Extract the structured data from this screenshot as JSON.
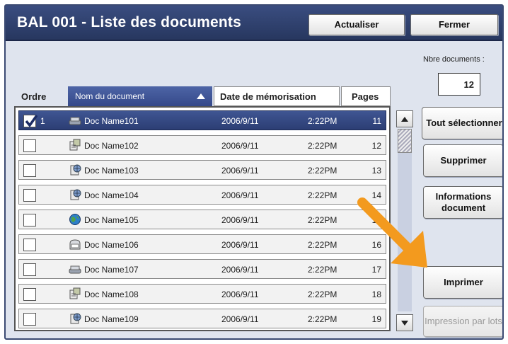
{
  "window": {
    "title": "BAL 001 - Liste des documents"
  },
  "toolbar": {
    "refresh_label": "Actualiser",
    "close_label": "Fermer"
  },
  "count": {
    "label": "Nbre documents :",
    "value": "12"
  },
  "columns": {
    "order": "Ordre",
    "name": "Nom du document",
    "date": "Date de mémorisation",
    "pages": "Pages"
  },
  "rows": [
    {
      "checked": true,
      "order": "1",
      "icon": "scanner-icon",
      "name": "Doc Name101",
      "date": "2006/9/11",
      "time": "2:22PM",
      "pages": "11"
    },
    {
      "checked": false,
      "order": "",
      "icon": "pc-document-icon",
      "name": "Doc Name102",
      "date": "2006/9/11",
      "time": "2:22PM",
      "pages": "12"
    },
    {
      "checked": false,
      "order": "",
      "icon": "network-document-icon",
      "name": "Doc Name103",
      "date": "2006/9/11",
      "time": "2:22PM",
      "pages": "13"
    },
    {
      "checked": false,
      "order": "",
      "icon": "network-document-icon",
      "name": "Doc Name104",
      "date": "2006/9/11",
      "time": "2:22PM",
      "pages": "14"
    },
    {
      "checked": false,
      "order": "",
      "icon": "globe-icon",
      "name": "Doc Name105",
      "date": "2006/9/11",
      "time": "2:22PM",
      "pages": "15"
    },
    {
      "checked": false,
      "order": "",
      "icon": "mailbox-icon",
      "name": "Doc Name106",
      "date": "2006/9/11",
      "time": "2:22PM",
      "pages": "16"
    },
    {
      "checked": false,
      "order": "",
      "icon": "scanner-icon",
      "name": "Doc Name107",
      "date": "2006/9/11",
      "time": "2:22PM",
      "pages": "17"
    },
    {
      "checked": false,
      "order": "",
      "icon": "pc-document-icon",
      "name": "Doc Name108",
      "date": "2006/9/11",
      "time": "2:22PM",
      "pages": "18"
    },
    {
      "checked": false,
      "order": "",
      "icon": "network-document-icon",
      "name": "Doc Name109",
      "date": "2006/9/11",
      "time": "2:22PM",
      "pages": "19"
    }
  ],
  "actions": {
    "select_all": "Tout sélectionner",
    "delete": "Supprimer",
    "info": "Informations document",
    "print": "Imprimer",
    "batch_print": "Impression par lots"
  },
  "colors": {
    "titlebar": "#2f4170",
    "selected_row": "#34477f",
    "highlight_arrow": "#f39a1e"
  }
}
